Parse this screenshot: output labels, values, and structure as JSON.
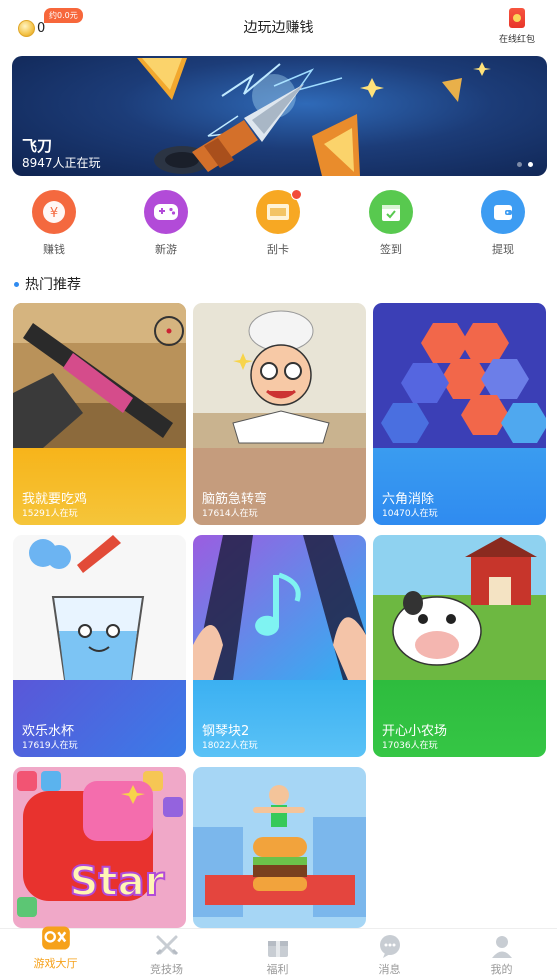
{
  "header": {
    "coin_count": "0",
    "approx_badge": "约0.0元",
    "title": "边玩边赚钱",
    "redpack_label": "在线红包"
  },
  "banner": {
    "title": "飞刀",
    "subtitle": "8947人正在玩",
    "dots": 2,
    "active_dot": 2
  },
  "quick_nav": [
    {
      "label": "赚钱",
      "icon": "yuan-coin-icon",
      "color": "#f4693f"
    },
    {
      "label": "新游",
      "icon": "gamepad-icon",
      "color": "#b24bd8"
    },
    {
      "label": "刮卡",
      "icon": "scratch-card-icon",
      "color": "#f7a823",
      "badge": true
    },
    {
      "label": "签到",
      "icon": "calendar-check-icon",
      "color": "#58c94f"
    },
    {
      "label": "提现",
      "icon": "wallet-icon",
      "color": "#3d9cf2"
    }
  ],
  "section": {
    "title": "热门推荐"
  },
  "games": [
    {
      "name": "我就要吃鸡",
      "players": "15291人在玩",
      "foot_color": "#f7b41a"
    },
    {
      "name": "脑筋急转弯",
      "players": "17614人在玩",
      "foot_color": "#c59c7d"
    },
    {
      "name": "六角消除",
      "players": "10470人在玩",
      "foot_color": "#2a9bf0"
    },
    {
      "name": "欢乐水杯",
      "players": "17619人在玩",
      "foot_color": "#3a7ce8"
    },
    {
      "name": "钢琴块2",
      "players": "18022人在玩",
      "foot_color": "#3bb0f2"
    },
    {
      "name": "开心小农场",
      "players": "17036人在玩",
      "foot_color": "#2ebc3e"
    },
    {
      "name": "",
      "players": "",
      "foot_color": "#f14a4a"
    },
    {
      "name": "",
      "players": "",
      "foot_color": "#3a9ce8"
    }
  ],
  "tabbar": [
    {
      "label": "游戏大厅",
      "icon": "game-hall-icon",
      "active": true
    },
    {
      "label": "竞技场",
      "icon": "crossed-swords-icon",
      "active": false
    },
    {
      "label": "福利",
      "icon": "gift-box-icon",
      "active": false
    },
    {
      "label": "消息",
      "icon": "chat-bubble-icon",
      "active": false
    },
    {
      "label": "我的",
      "icon": "user-icon",
      "active": false
    }
  ],
  "colors": {
    "accent": "#f6a11a",
    "badge": "#f7673b",
    "section_bullet": "#2f8bf0"
  }
}
